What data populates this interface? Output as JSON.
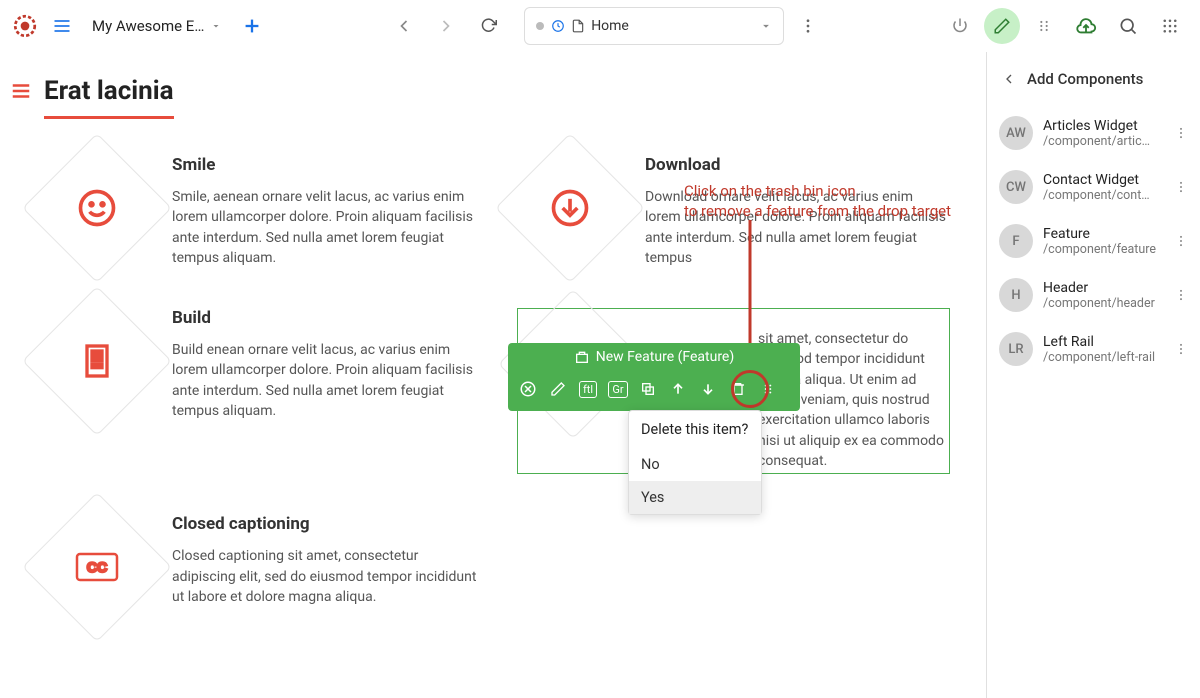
{
  "toolbar": {
    "site_name": "My Awesome E…",
    "url_label": "Home"
  },
  "page": {
    "title": "Erat lacinia"
  },
  "annotation": {
    "line1": "Click on the trash bin icon",
    "line2": "to remove a feature from the drop target"
  },
  "edit_bar": {
    "label": "New Feature (Feature)"
  },
  "delete_popup": {
    "question": "Delete this item?",
    "no": "No",
    "yes": "Yes"
  },
  "features": [
    {
      "title": "Smile",
      "body": "Smile, aenean ornare velit lacus, ac varius enim lorem ullamcorper dolore. Proin aliquam facilisis ante interdum. Sed nulla amet lorem feugiat tempus aliquam."
    },
    {
      "title": "Download",
      "body": "Download ornare velit lacus, ac varius enim lorem ullamcorper dolore. Proin aliquam facilisis ante interdum. Sed nulla amet lorem feugiat tempus"
    },
    {
      "title": "Build",
      "body": "Build enean ornare velit lacus, ac varius enim lorem ullamcorper dolore. Proin aliquam facilisis ante interdum. Sed nulla amet lorem feugiat tempus aliquam."
    },
    {
      "title": "",
      "body": "sit amet, consectetur do eiusmod tempor incididunt magna aliqua. Ut enim ad minim veniam, quis nostrud exercitation ullamco laboris nisi ut aliquip ex ea commodo consequat."
    },
    {
      "title": "Closed captioning",
      "body": "Closed captioning sit amet, consectetur adipiscing elit, sed do eiusmod tempor incididunt ut labore et dolore magna aliqua."
    }
  ],
  "panel": {
    "title": "Add Components",
    "items": [
      {
        "avatar": "AW",
        "name": "Articles Widget",
        "path": "/component/artic…"
      },
      {
        "avatar": "CW",
        "name": "Contact Widget",
        "path": "/component/cont…"
      },
      {
        "avatar": "F",
        "name": "Feature",
        "path": "/component/feature"
      },
      {
        "avatar": "H",
        "name": "Header",
        "path": "/component/header"
      },
      {
        "avatar": "LR",
        "name": "Left Rail",
        "path": "/component/left-rail"
      }
    ]
  }
}
